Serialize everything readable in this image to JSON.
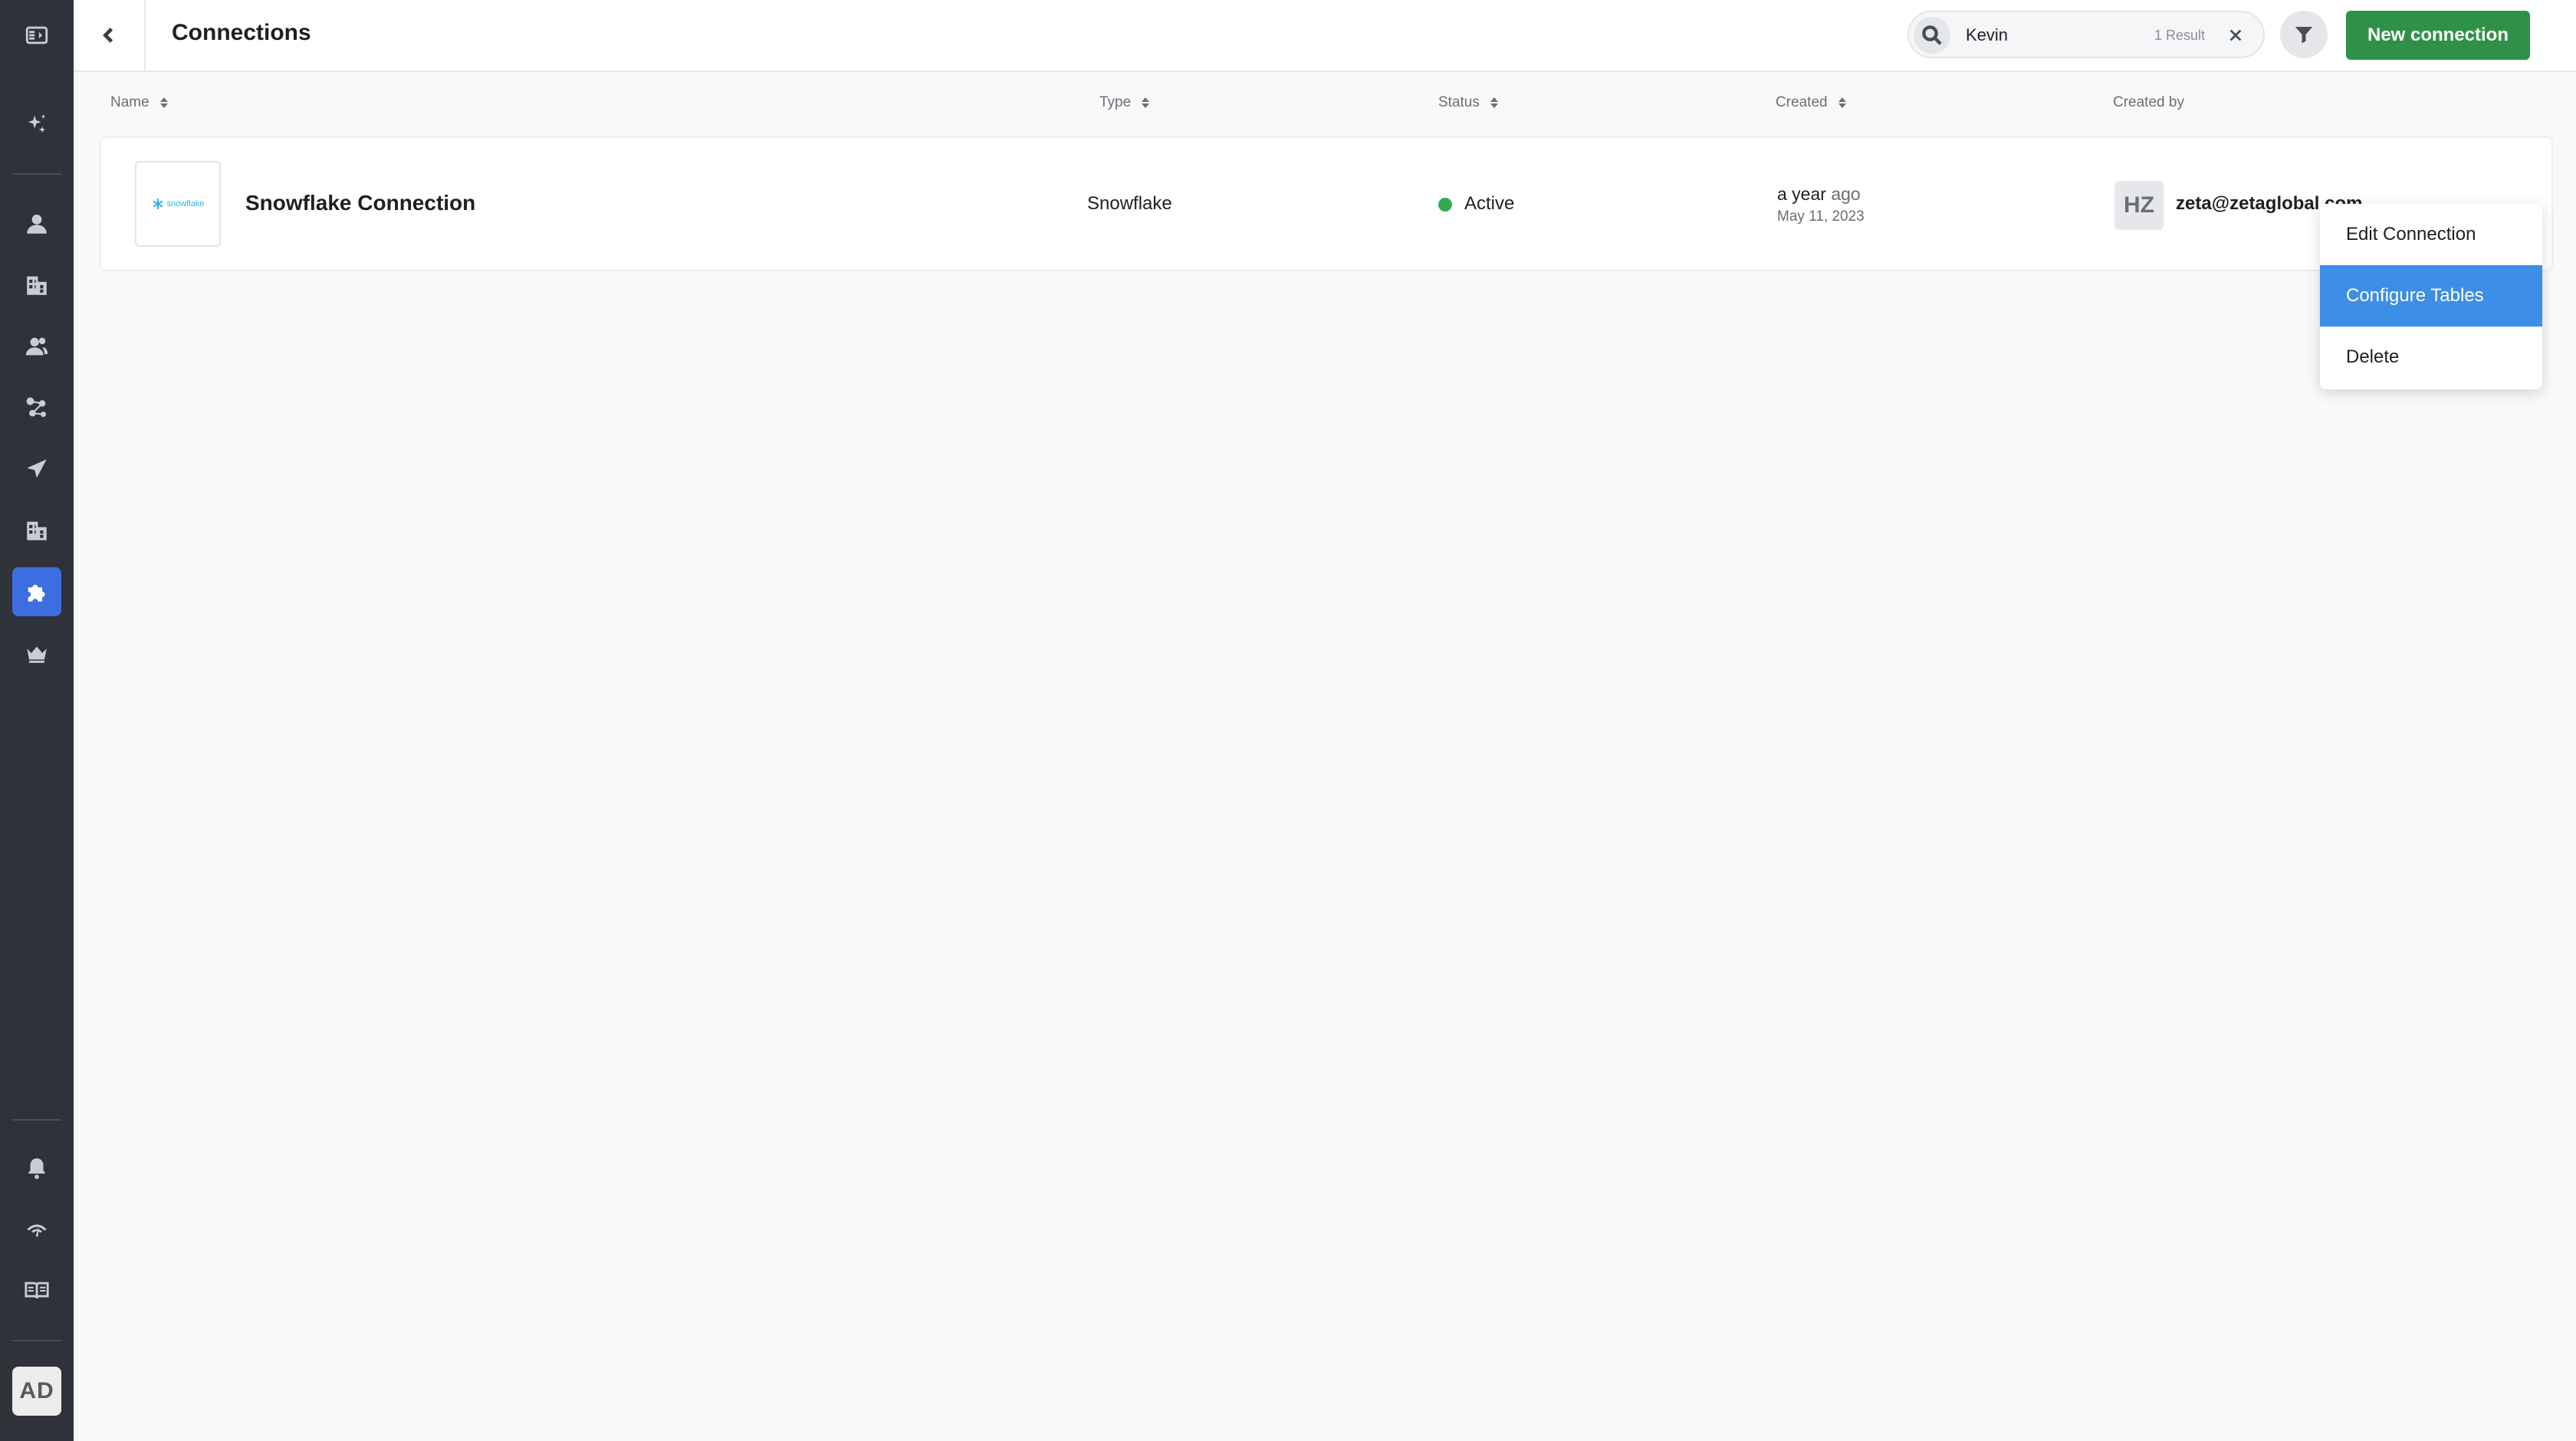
{
  "app": {
    "user_initials": "AD"
  },
  "header": {
    "title": "Connections",
    "search_value": "Kevin",
    "result_count": "1 Result",
    "new_button": "New connection"
  },
  "table": {
    "columns": [
      "Name",
      "Type",
      "Status",
      "Created",
      "Created by"
    ],
    "rows": [
      {
        "name": "Snowflake Connection",
        "logo_text": "snowflake",
        "type": "Snowflake",
        "status": "Active",
        "status_color": "#34a853",
        "created_relative": "a year",
        "created_ago": "ago",
        "created_date": "May 11, 2023",
        "creator_initials": "HZ",
        "creator_email": "zeta@zetaglobal.com"
      }
    ]
  },
  "context_menu": {
    "items": [
      "Edit Connection",
      "Configure Tables",
      "Delete"
    ],
    "highlighted": "Configure Tables"
  },
  "sidebar": {
    "icons": [
      "toggle-sidebar-icon",
      "sparkle-icon",
      "person-icon",
      "building-icon",
      "people-icon",
      "segments-icon",
      "send-icon",
      "company-icon",
      "puzzle-icon",
      "crown-icon",
      "bell-icon",
      "signal-icon",
      "book-icon"
    ],
    "active": "puzzle-icon"
  }
}
